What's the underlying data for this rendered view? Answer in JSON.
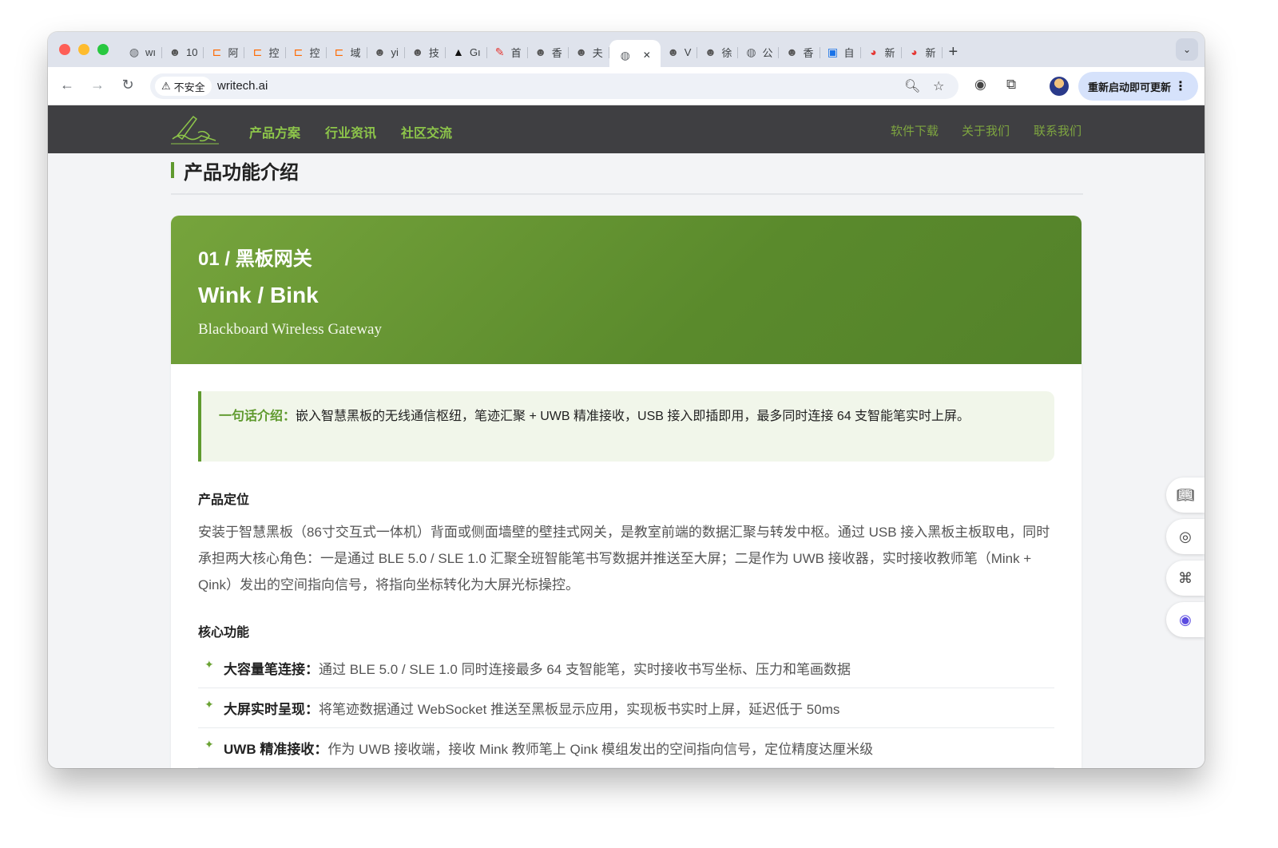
{
  "browser": {
    "tabs": [
      {
        "label": "wı",
        "icon": "globe-icon",
        "color": "#5f6368"
      },
      {
        "label": "10",
        "icon": "avatar-icon",
        "color": "#555"
      },
      {
        "label": "阿",
        "icon": "bracket-icon",
        "color": "#ff6a00"
      },
      {
        "label": "控",
        "icon": "bracket-icon",
        "color": "#ff6a00"
      },
      {
        "label": "控",
        "icon": "bracket-icon",
        "color": "#ff6a00"
      },
      {
        "label": "域",
        "icon": "bracket-icon",
        "color": "#ff6a00"
      },
      {
        "label": "yi",
        "icon": "avatar-icon",
        "color": "#555"
      },
      {
        "label": "技",
        "icon": "avatar-icon",
        "color": "#555"
      },
      {
        "label": "Gı",
        "icon": "triangle-icon",
        "color": "#111"
      },
      {
        "label": "首",
        "icon": "feather-icon",
        "color": "#e53935"
      },
      {
        "label": "香",
        "icon": "avatar-icon",
        "color": "#555"
      },
      {
        "label": "夫",
        "icon": "avatar-icon",
        "color": "#555"
      },
      {
        "label": "",
        "icon": "globe-icon",
        "color": "#5f6368",
        "active": true
      },
      {
        "label": "V",
        "icon": "avatar-icon",
        "color": "#555"
      },
      {
        "label": "徐",
        "icon": "avatar-icon",
        "color": "#555"
      },
      {
        "label": "公",
        "icon": "globe-icon",
        "color": "#5f6368"
      },
      {
        "label": "香",
        "icon": "avatar-icon",
        "color": "#555"
      },
      {
        "label": "自",
        "icon": "box-icon",
        "color": "#1a73e8"
      },
      {
        "label": "新",
        "icon": "weibo-icon",
        "color": "#e53935"
      },
      {
        "label": "新",
        "icon": "weibo-icon",
        "color": "#e53935"
      }
    ],
    "close_glyph": "✕",
    "new_tab_glyph": "+",
    "insecure_label": "不安全",
    "url": "writech.ai",
    "update_label": "重新启动即可更新"
  },
  "site": {
    "nav_left": [
      "产品方案",
      "行业资讯",
      "社区交流"
    ],
    "nav_right": [
      "软件下载",
      "关于我们",
      "联系我们"
    ],
    "accent": "#8dc54a"
  },
  "section": {
    "title": "产品功能介绍"
  },
  "product": {
    "number_title": "01 / 黑板网关",
    "name": "Wink / Bink",
    "subtitle": "Blackboard Wireless Gateway",
    "intro_label": "一句话介绍：",
    "intro_text": "嵌入智慧黑板的无线通信枢纽，笔迹汇聚 + UWB 精准接收，USB 接入即插即用，最多同时连接 64 支智能笔实时上屏。",
    "positioning_heading": "产品定位",
    "positioning_text": "安装于智慧黑板（86寸交互式一体机）背面或侧面墙壁的壁挂式网关，是教室前端的数据汇聚与转发中枢。通过 USB 接入黑板主板取电，同时承担两大核心角色：一是通过 BLE 5.0 / SLE 1.0 汇聚全班智能笔书写数据并推送至大屏；二是作为 UWB 接收器，实时接收教师笔（Mink + Qink）发出的空间指向信号，将指向坐标转化为大屏光标操控。",
    "features_heading": "核心功能",
    "features": [
      {
        "name": "大容量笔连接：",
        "desc": "通过 BLE 5.0 / SLE 1.0 同时连接最多 64 支智能笔，实时接收书写坐标、压力和笔画数据"
      },
      {
        "name": "大屏实时呈现：",
        "desc": "将笔迹数据通过 WebSocket 推送至黑板显示应用，实现板书实时上屏，延迟低于 50ms"
      },
      {
        "name": "UWB 精准接收：",
        "desc": "作为 UWB 接收端，接收 Mink 教师笔上 Qink 模组发出的空间指向信号，定位精度达厘米级"
      }
    ]
  }
}
